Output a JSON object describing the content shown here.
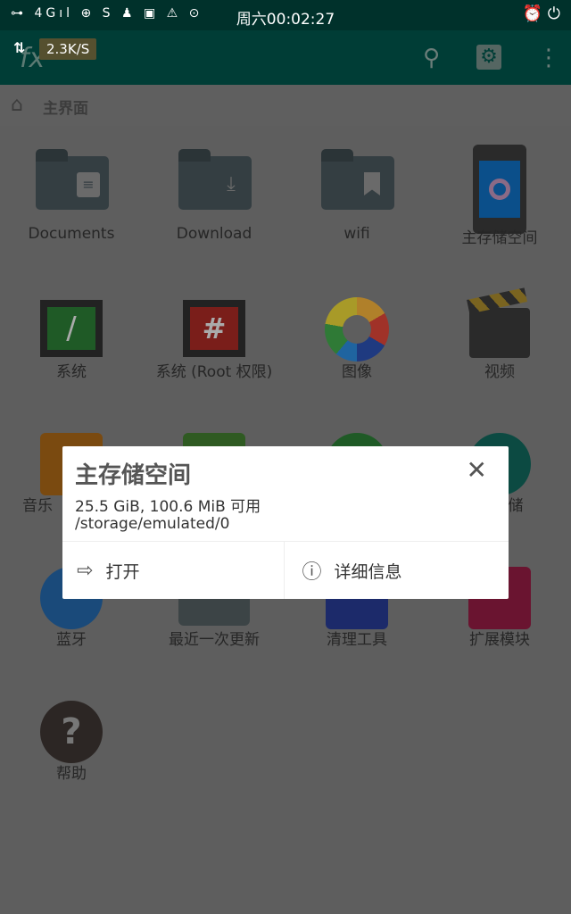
{
  "status_bar": {
    "left_icons": [
      "key-icon",
      "4g-signal-icon",
      "sync-icon",
      "s-app-icon",
      "qq-icon",
      "image-icon",
      "warning-icon",
      "more-icon"
    ],
    "network_label": "4G",
    "time": "周六00:02:27",
    "right_icons": [
      "alarm-icon",
      "charging-icon"
    ]
  },
  "app_bar": {
    "speed": "2.3K/S",
    "actions": [
      "search-icon",
      "settings-icon",
      "more-vert-icon"
    ]
  },
  "breadcrumb": {
    "label": "主界面"
  },
  "grid": [
    {
      "label": "Documents",
      "icon": "folder-documents-icon"
    },
    {
      "label": "Download",
      "icon": "folder-download-icon"
    },
    {
      "label": "wifi",
      "icon": "folder-bookmark-icon"
    },
    {
      "label": "主存储空间",
      "icon": "phone-storage-icon"
    },
    {
      "label": "系统",
      "icon": "terminal-root-icon",
      "glyph": "/"
    },
    {
      "label": "系统 (Root 权限)",
      "icon": "terminal-hash-icon",
      "glyph": "#"
    },
    {
      "label": "图像",
      "icon": "image-gallery-icon"
    },
    {
      "label": "视频",
      "icon": "clapperboard-icon"
    },
    {
      "label": "音乐",
      "icon": "music-icon"
    },
    {
      "label": "",
      "icon": "android-icon"
    },
    {
      "label": "",
      "icon": "network-icon"
    },
    {
      "label": "储",
      "icon": "storage-icon"
    },
    {
      "label": "蓝牙",
      "icon": "bluetooth-icon"
    },
    {
      "label": "最近一次更新",
      "icon": "recent-icon"
    },
    {
      "label": "清理工具",
      "icon": "cleaner-icon"
    },
    {
      "label": "扩展模块",
      "icon": "extension-icon"
    },
    {
      "label": "帮助",
      "icon": "help-icon",
      "glyph": "?"
    }
  ],
  "dialog": {
    "title": "主存储空间",
    "size_info": "25.5 GiB, 100.6 MiB 可用",
    "path": "/storage/emulated/0",
    "open_label": "打开",
    "details_label": "详细信息"
  }
}
